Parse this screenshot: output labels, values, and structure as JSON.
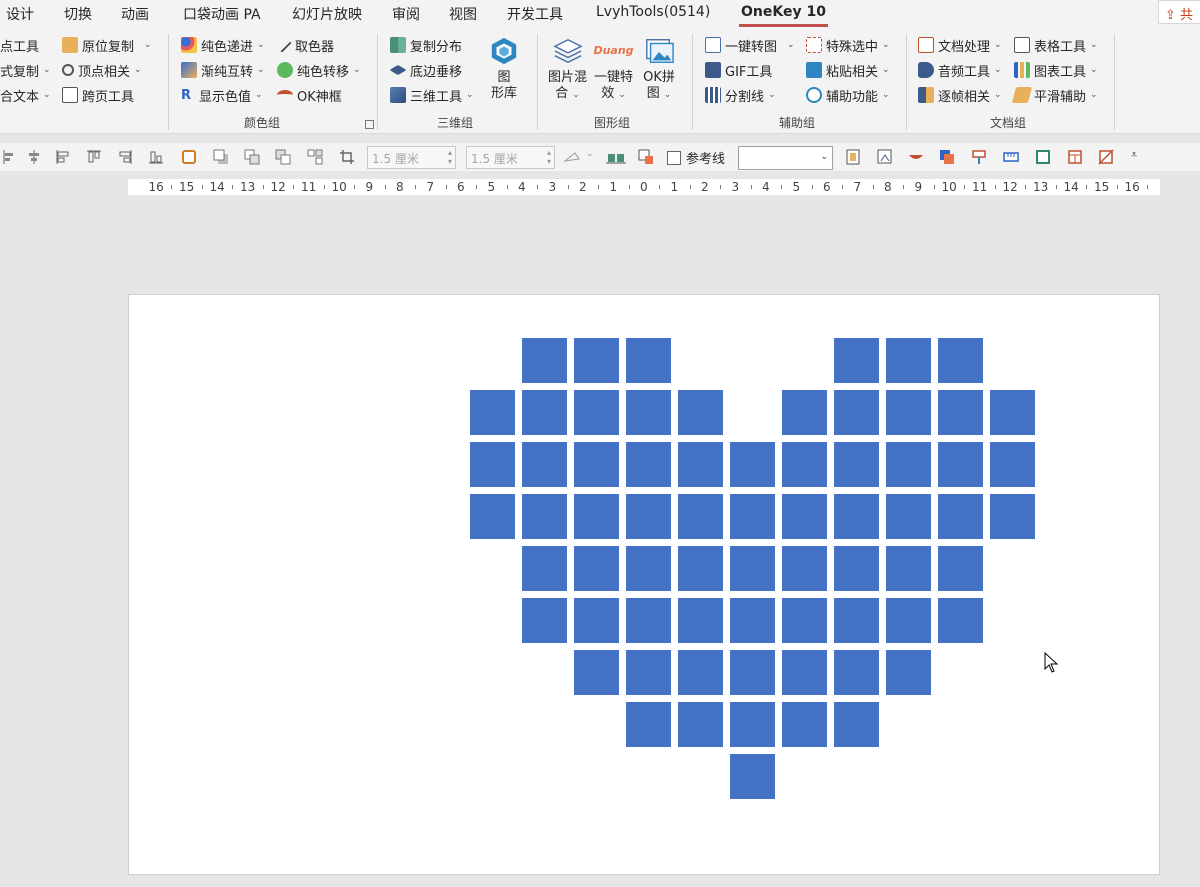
{
  "tabs": {
    "design": "设计",
    "transitions": "切换",
    "animations": "动画",
    "pocket_animation": "口袋动画 PA",
    "slideshow": "幻灯片放映",
    "review": "审阅",
    "view": "视图",
    "developer": "开发工具",
    "lvyh": "LvyhTools(0514)",
    "onekey": "OneKey 10"
  },
  "share_label": "共",
  "ribbon": {
    "col1": [
      "点工具",
      "式复制",
      "合文本"
    ],
    "col2": [
      "原位复制",
      "顶点相关",
      "跨页工具"
    ],
    "color_group": {
      "label": "颜色组",
      "items": [
        "纯色递进",
        "取色器",
        "渐纯互转",
        "纯色转移",
        "显示色值",
        "OK神框"
      ]
    },
    "three_d_group": {
      "label": "三维组",
      "items": [
        "复制分布",
        "底边垂移",
        "三维工具"
      ],
      "big_line1": "图",
      "big_line2": "形库"
    },
    "shape_group": {
      "label": "图形组",
      "mix_line1": "图片混",
      "mix_line2": "合",
      "effect_line1": "一键特",
      "effect_line2": "效",
      "duang": "Duang",
      "ok_line1": "OK拼",
      "ok_line2": "图"
    },
    "aux_group": {
      "label": "辅助组",
      "items": [
        "一键转图",
        "特殊选中",
        "GIF工具",
        "粘贴相关",
        "分割线",
        "辅助功能"
      ]
    },
    "doc_group": {
      "label": "文档组",
      "items": [
        "文档处理",
        "表格工具",
        "音频工具",
        "图表工具",
        "逐帧相关",
        "平滑辅助"
      ]
    }
  },
  "toolbar": {
    "height_value": "1.5 厘米",
    "width_value": "1.5 厘米",
    "ref_line": "参考线"
  },
  "ruler": {
    "labels": [
      "16",
      "15",
      "14",
      "13",
      "12",
      "11",
      "10",
      "9",
      "8",
      "7",
      "6",
      "5",
      "4",
      "3",
      "2",
      "1",
      "0",
      "1",
      "2",
      "3",
      "4",
      "5",
      "6",
      "7",
      "8",
      "9",
      "10",
      "11",
      "12",
      "13",
      "14",
      "15",
      "16"
    ]
  },
  "slide": {
    "shape_color": "#4472c4",
    "heart_rows": [
      [
        1,
        2,
        3,
        7,
        8,
        9
      ],
      [
        0,
        1,
        2,
        3,
        4,
        6,
        7,
        8,
        9,
        10
      ],
      [
        0,
        1,
        2,
        3,
        4,
        5,
        6,
        7,
        8,
        9,
        10
      ],
      [
        0,
        1,
        2,
        3,
        4,
        5,
        6,
        7,
        8,
        9,
        10
      ],
      [
        1,
        2,
        3,
        4,
        5,
        6,
        7,
        8,
        9
      ],
      [
        1,
        2,
        3,
        4,
        5,
        6,
        7,
        8,
        9
      ],
      [
        2,
        3,
        4,
        5,
        6,
        7,
        8
      ],
      [
        3,
        4,
        5,
        6,
        7
      ],
      [
        5
      ]
    ]
  }
}
